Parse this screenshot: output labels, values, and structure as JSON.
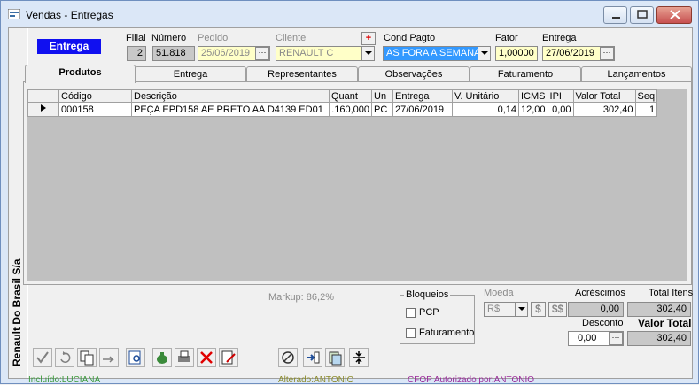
{
  "window": {
    "title": "Vendas - Entregas",
    "side_label": "Renault Do Brasil S/a"
  },
  "header": {
    "entrega_badge": "Entrega",
    "filial_label": "Filial",
    "filial_value": "2",
    "numero_label": "Número",
    "numero_value": "51.818",
    "pedido_label": "Pedido",
    "pedido_value": "25/06/2019",
    "cliente_label": "Cliente",
    "cliente_value": "RENAULT  C",
    "add_cliente_label": "+",
    "cond_pagto_label": "Cond Pagto",
    "cond_pagto_value": "AS FORA A SEMANA",
    "fator_label": "Fator",
    "fator_value": "1,00000",
    "entrega_label": "Entrega",
    "entrega_value": "27/06/2019"
  },
  "tabs": [
    {
      "label": "Produtos"
    },
    {
      "label": "Entrega"
    },
    {
      "label": "Representantes"
    },
    {
      "label": "Observações"
    },
    {
      "label": "Faturamento"
    },
    {
      "label": "Lançamentos"
    }
  ],
  "grid": {
    "columns": [
      "Código",
      "Descrição",
      "Quant",
      "Un",
      "Entrega",
      "V. Unitário",
      "ICMS",
      "IPI",
      "Valor Total",
      "Seq"
    ],
    "rows": [
      {
        "codigo": "000158",
        "descricao": "PEÇA EPD158 AE PRETO AA D4139 ED01",
        "quant": ".160,000",
        "un": "PC",
        "entrega": "27/06/2019",
        "v_unitario": "0,14",
        "icms": "12,00",
        "ipi": "0,00",
        "valor_total": "302,40",
        "seq": "1"
      }
    ]
  },
  "footer": {
    "markup": "Markup: 86,2%",
    "bloqueios_label": "Bloqueios",
    "pcp_label": "PCP",
    "faturamento_label": "Faturamento",
    "moeda_label": "Moeda",
    "moeda_value": "R$",
    "acrescimos_label": "Acréscimos",
    "acrescimos_value": "0,00",
    "total_itens_label": "Total Itens",
    "total_itens_value": "302,40",
    "desconto_label": "Desconto",
    "desconto_value": "0,00",
    "valor_total_label": "Valor Total",
    "valor_total_value": "302,40",
    "incluido": "Incluído:LUCIANA",
    "alterado": "Alterado:ANTONIO",
    "cfop": "CFOP Autorizado por:ANTONIO"
  },
  "colors": {
    "badge_bg": "#1010f0",
    "incluido": "#3a9a3a",
    "alterado": "#8a8a2a",
    "cfop": "#9a2a9a",
    "selection": "#3399ff"
  }
}
